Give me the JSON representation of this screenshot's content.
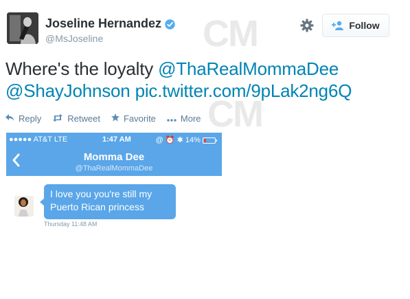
{
  "user": {
    "name": "Joseline Hernandez",
    "handle": "@MsJoseline"
  },
  "watermark": "CM",
  "follow_label": "Follow",
  "tweet": {
    "prefix": "Where's the loyalty ",
    "mention1": "@ThaRealMommaDee",
    "mention2": "@ShayJohnson",
    "link": "pic.twitter.com/9pLak2ng6Q"
  },
  "actions": {
    "reply": "Reply",
    "retweet": "Retweet",
    "favorite": "Favorite",
    "more": "More"
  },
  "phone": {
    "carrier": "●●●●● AT&T  LTE",
    "time": "1:47 AM",
    "status_right": "@ ⏰ ✱ 14%",
    "contact_name": "Momma Dee",
    "contact_handle": "@ThaRealMommaDee",
    "message": "I love you you're still my Puerto Rican princess",
    "message_time": "Thursday 11:48 AM"
  },
  "colors": {
    "link": "#0084b4",
    "ios_blue": "#5aa6e8"
  }
}
